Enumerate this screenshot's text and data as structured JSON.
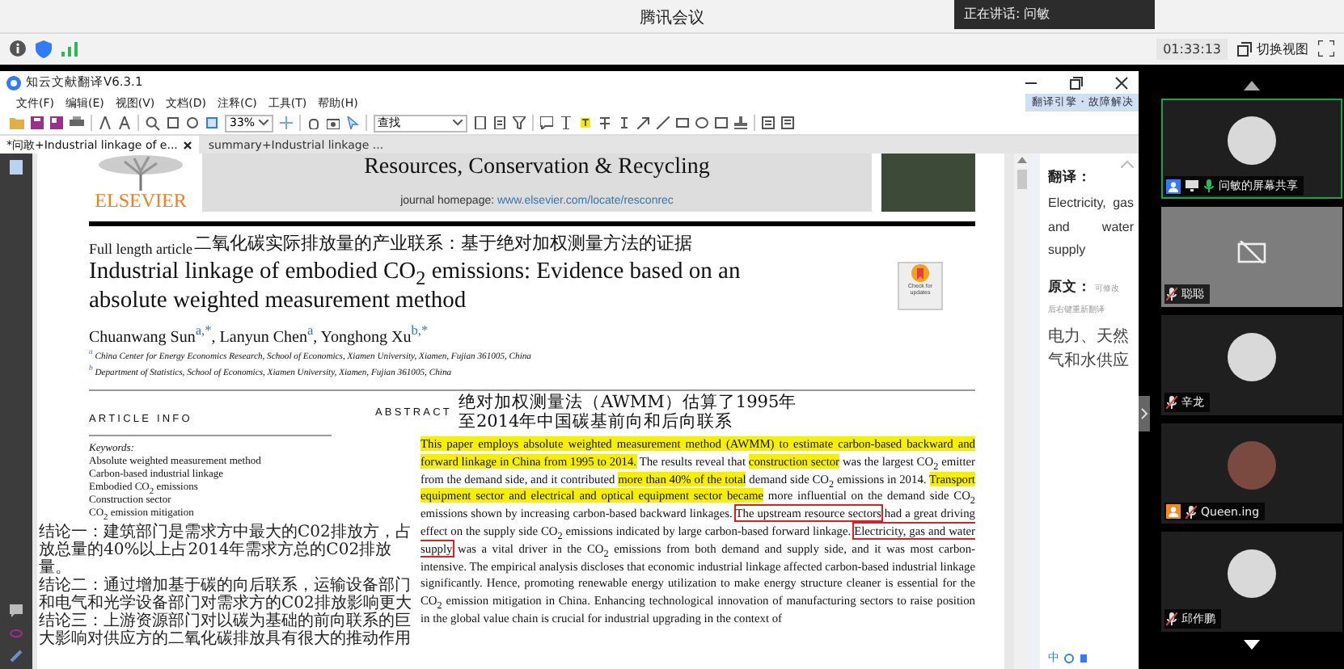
{
  "meeting": {
    "title": "腾讯会议",
    "speaking": "正在讲话: 问敏",
    "timer": "01:33:13",
    "switch_view": "切换视图"
  },
  "app": {
    "title": "知云文献翻译V6.3.1",
    "menu": [
      "文件(F)",
      "编辑(E)",
      "视图(V)",
      "文档(D)",
      "注释(C)",
      "工具(T)",
      "帮助(H)"
    ],
    "zoom": "33%",
    "search_mode": "查找",
    "tabs": [
      {
        "label": "*问敢+Industrial linkage of e...",
        "selected": true,
        "closable": true
      },
      {
        "label": "summary+Industrial linkage ...",
        "selected": false,
        "closable": false
      }
    ]
  },
  "document": {
    "publisher": "ELSEVIER",
    "journal": "Resources, Conservation & Recycling",
    "homepage_label": "journal homepage:",
    "homepage_url": "www.elsevier.com/locate/resconrec",
    "article_type": "Full length article",
    "title_translation": "二氧化碳实际排放量的产业联系：基于绝对加权测量方法的证据",
    "title": "Industrial linkage of embodied CO$_{2}$ emissions: Evidence based on an absolute weighted measurement method",
    "check_updates": "Check for updates",
    "authors": "Chuanwang Sun$^{a,*}$, Lanyun Chen$^{a}$, Yonghong Xu$^{b,*}$",
    "affiliations": [
      "$^{a}$ China Center for Energy Economics Research, School of Economics, Xiamen University, Xiamen, Fujian 361005, China",
      "$^{b}$ Department of Statistics, School of Economics, Xiamen University, Xiamen, Fujian 361005, China"
    ],
    "article_info_heading": "ARTICLE INFO",
    "keywords_heading": "Keywords:",
    "keywords": [
      "Absolute weighted measurement method",
      "Carbon-based industrial linkage",
      "Embodied CO$_{2}$ emissions",
      "Construction sector",
      "CO$_{2}$ emission mitigation"
    ],
    "abstract_heading": "ABSTRACT",
    "abstract_translation": "绝对加权测量法（AWMM）估算了1995年至2014年中国碳基前向和后向联系",
    "abstract": [
      {
        "kind": "highlight",
        "text": "This paper employs absolute weighted measurement method (AWMM) to estimate carbon-based backward and forward linkage in China from 1995 to 2014."
      },
      {
        "kind": "plain",
        "text": " The results reveal that "
      },
      {
        "kind": "highlight",
        "text": "construction sector"
      },
      {
        "kind": "plain",
        "text": " was the largest CO$_{2}$ emitter from the demand side, and it contributed "
      },
      {
        "kind": "highlight",
        "text": "more than 40% of the total"
      },
      {
        "kind": "plain",
        "text": " demand side CO$_{2}$ emissions in 2014. "
      },
      {
        "kind": "highlight",
        "text": "Transport equipment sector and electrical and optical equipment sector became"
      },
      {
        "kind": "plain",
        "text": " more influential on the demand side CO$_{2}$ emissions shown by increasing carbon-based backward linkages. "
      },
      {
        "kind": "boxed",
        "text": "The upstream resource sectors"
      },
      {
        "kind": "plain",
        "text": " had a great driving effect on the supply side CO$_{2}$ emissions indicated by large carbon-based forward linkage. "
      },
      {
        "kind": "boxed",
        "text": "Electricity, gas and water supply"
      },
      {
        "kind": "plain",
        "text": " was a vital driver in the CO$_{2}$ emissions from both demand and supply side, and it was most carbon-intensive. The empirical analysis discloses that economic industrial linkage affected carbon-based industrial linkage significantly. Hence, promoting renewable energy utilization to make energy structure cleaner is essential for the CO$_{2}$ emission mitigation in China. Enhancing technological innovation of manufacturing sectors to raise position in the global value chain is crucial for industrial upgrading in the context of"
      }
    ],
    "conclusions": [
      "结论一：建筑部门是需求方中最大的C02排放方，占放总量的40%以上占2014年需求方总的C02排放量。",
      "结论二：通过增加基于碳的向后联系，运输设备部门和电气和光学设备部门对需求方的C02排放影响更大",
      "结论三：上游资源部门对以碳为基础的前向联系的巨大影响对供应方的二氧化碳排放具有很大的推动作用"
    ]
  },
  "translation_panel": {
    "header": "翻译引擎・故障解决",
    "translation_label": "翻译：",
    "translation": "Electricity, gas and water supply",
    "source_label": "原文：",
    "source_hint": "可修改",
    "retranslate_hint": "后右键重新翻译",
    "source": "电力、天然气和水供应"
  },
  "ime_bar": {
    "label": "中"
  },
  "participants": [
    {
      "name": "问敏的屏幕共享",
      "kind": "avatar",
      "color": "#2f7cf6",
      "sharing": true,
      "muted": false,
      "speaking": true
    },
    {
      "name": "聪聪",
      "kind": "camera-off",
      "sharing": false,
      "muted": true,
      "speaking": false
    },
    {
      "name": "辛龙",
      "kind": "avatar",
      "sharing": false,
      "muted": true,
      "speaking": false
    },
    {
      "name": "Queen.ing",
      "kind": "photo",
      "color": "#f08a24",
      "sharing": false,
      "muted": true,
      "speaking": false
    },
    {
      "name": "邱作鹏",
      "kind": "avatar",
      "sharing": false,
      "muted": true,
      "speaking": false
    }
  ]
}
